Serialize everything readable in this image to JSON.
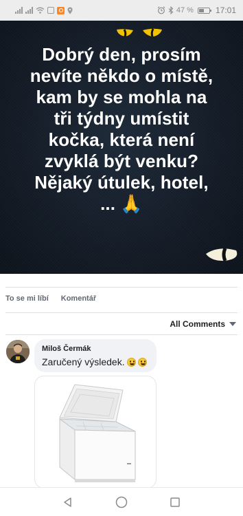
{
  "status_bar": {
    "battery": "47 %",
    "time": "17:01",
    "icons": [
      "signal-icon",
      "signal-icon",
      "wifi-icon",
      "nfc-icon",
      "notification-icon",
      "location-icon",
      "alarm-icon",
      "bluetooth-icon",
      "battery-icon"
    ]
  },
  "post": {
    "text_lines": [
      "Dobrý den, prosím",
      "nevíte někdo o místě,",
      "kam by se mohla na",
      "tři týdny umístit",
      "kočka, která není",
      "zvyklá být venku?",
      "Nějaký útulek, hotel,",
      "... 🙏"
    ]
  },
  "actions": {
    "like": "To se mi líbí",
    "comment": "Komentář"
  },
  "comments_filter": {
    "label": "All Comments"
  },
  "comment": {
    "author": "Miloš Čermák",
    "text": "Zaručený výsledek.",
    "emoji_count": 2
  },
  "colors": {
    "image_bg": "#141c27",
    "eye_yellow": "#f2c200",
    "bubble_bg": "#f0f2f5",
    "action_text": "#606770"
  }
}
